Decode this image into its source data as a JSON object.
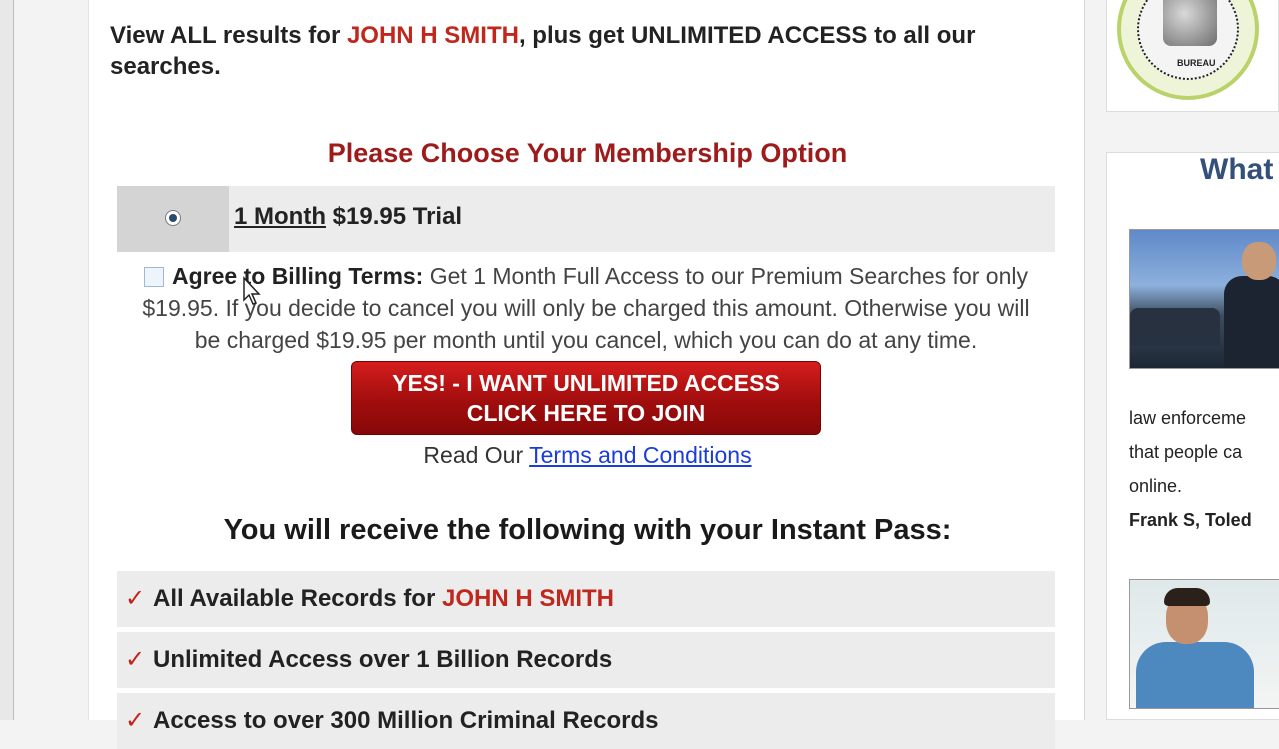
{
  "intro": {
    "prefix": "View ALL results for ",
    "name": "JOHN H SMITH",
    "suffix": ", plus get UNLIMITED ACCESS to all our searches."
  },
  "membership": {
    "title": "Please Choose Your Membership Option",
    "option": {
      "duration": "1 Month",
      "price_label": "$19.95 Trial",
      "selected": true
    },
    "agreement": {
      "label": "Agree to Billing Terms:",
      "text": "Get 1 Month Full Access to our Premium Searches for only $19.95. If you decide to cancel you will only be charged this amount. Otherwise you will be charged $19.95 per month until you cancel, which you can do at any time.",
      "checked": false
    },
    "join_button": {
      "line1": "YES! - I WANT UNLIMITED ACCESS",
      "line2": "CLICK HERE TO JOIN"
    },
    "terms": {
      "prefix": "Read Our ",
      "link_label": "Terms and Conditions"
    }
  },
  "benefits": {
    "title": "You will receive the following with your Instant Pass:",
    "items": [
      {
        "text": "All Available Records for ",
        "highlight": "JOHN H SMITH"
      },
      {
        "text": "Unlimited Access over 1 Billion Records",
        "highlight": ""
      },
      {
        "text": "Access to over 300 Million Criminal Records",
        "highlight": ""
      }
    ]
  },
  "sidebar": {
    "badge_text": "BUREAU",
    "panel_title": "What",
    "testimonial_lines": [
      "law enforceme",
      "that people ca",
      "online."
    ],
    "testimonial_author": "Frank S, Toled"
  },
  "colors": {
    "accent_red": "#c0271d",
    "title_red": "#9d1b1b",
    "link_blue": "#1a3cd8",
    "sidebar_title": "#34507a"
  },
  "icons": [
    "radio-button-selected",
    "checkbox-unchecked",
    "mouse-pointer",
    "check-mark"
  ]
}
